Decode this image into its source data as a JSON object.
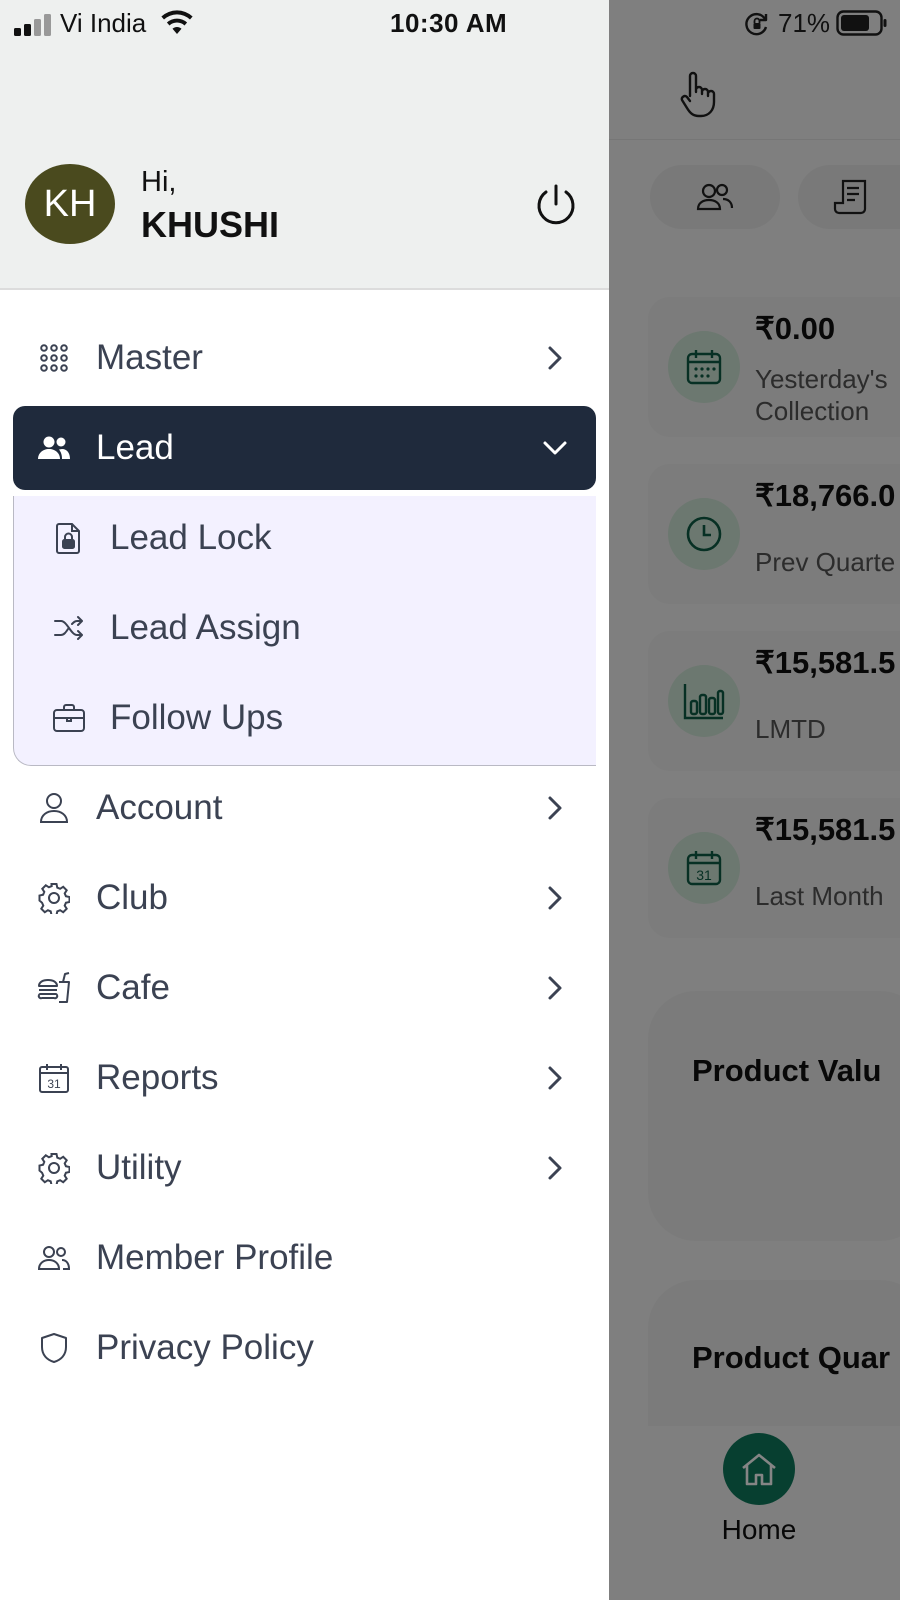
{
  "status_bar": {
    "carrier": "Vi India",
    "time": "10:30 AM",
    "battery": "71%"
  },
  "drawer": {
    "avatar_initials": "KH",
    "greeting": "Hi,",
    "user_name": "KHUSHI",
    "menu": [
      {
        "label": "Master",
        "icon": "grid-dots-icon",
        "expandable": true
      },
      {
        "label": "Lead",
        "icon": "users-icon",
        "expandable": true,
        "expanded": true
      },
      {
        "label": "Account",
        "icon": "user-icon",
        "expandable": true
      },
      {
        "label": "Club",
        "icon": "gear-icon",
        "expandable": true
      },
      {
        "label": "Cafe",
        "icon": "food-icon",
        "expandable": true
      },
      {
        "label": "Reports",
        "icon": "calendar-icon",
        "expandable": true
      },
      {
        "label": "Utility",
        "icon": "gear-icon",
        "expandable": true
      },
      {
        "label": "Member Profile",
        "icon": "users-outline-icon",
        "expandable": false
      },
      {
        "label": "Privacy Policy",
        "icon": "shield-icon",
        "expandable": false
      }
    ],
    "lead_submenu": [
      {
        "label": "Lead Lock",
        "icon": "file-lock-icon"
      },
      {
        "label": "Lead Assign",
        "icon": "shuffle-icon"
      },
      {
        "label": "Follow Ups",
        "icon": "briefcase-icon"
      }
    ]
  },
  "background": {
    "stats": [
      {
        "value": "₹0.00",
        "label": "Yesterday's\nCollection",
        "icon": "calendar-grid-icon"
      },
      {
        "value": "₹18,766.0",
        "label": "Prev Quarte",
        "icon": "clock-icon"
      },
      {
        "value": "₹15,581.5",
        "label": "LMTD",
        "icon": "bar-chart-icon"
      },
      {
        "value": "₹15,581.5",
        "label": "Last Month",
        "icon": "calendar-31-icon"
      }
    ],
    "cards": [
      {
        "title": "Product Valu"
      },
      {
        "title": "Product Quar"
      }
    ],
    "bottom_nav": {
      "home_label": "Home"
    },
    "accent_color": "#0f7a5c"
  }
}
